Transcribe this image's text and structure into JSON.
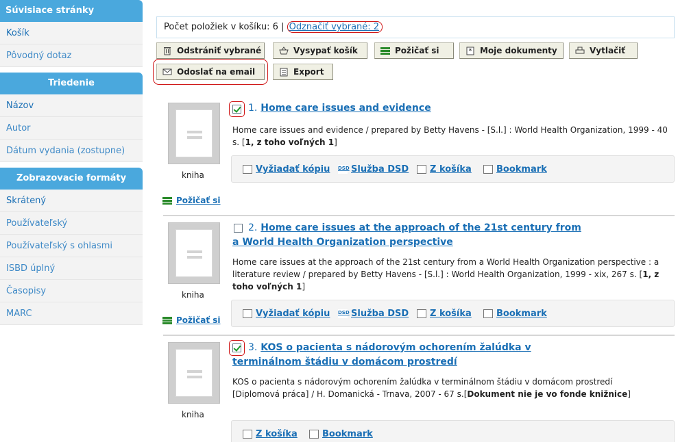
{
  "sidebar": {
    "related_title": "Súvisiace stránky",
    "related_items": [
      "Košík",
      "Pôvodný dotaz"
    ],
    "sort_title": "Triedenie",
    "sort_items": [
      "Názov",
      "Autor",
      "Dátum vydania (zostupne)"
    ],
    "formats_title": "Zobrazovacie formáty",
    "formats_items": [
      "Skrátený",
      "Používateľský",
      "Používateľský s ohlasmi",
      "ISBD úplný",
      "Časopisy",
      "MARC"
    ]
  },
  "cart": {
    "count_label": "Počet položiek v košíku: 6 |",
    "deselect_label": "Odznačiť vybrané: 2"
  },
  "toolbar": {
    "remove": "Odstrániť vybrané",
    "empty": "Vysypať košík",
    "borrow": "Požičať si",
    "mydocs": "Moje dokumenty",
    "print": "Vytlačiť",
    "email": "Odoslať na email",
    "export": "Export"
  },
  "records": [
    {
      "num": "1.",
      "title": "Home care issues and evidence",
      "desc": "Home care issues and evidence / prepared by Betty Havens - [S.l.] : World Health Organization, 1999 - 40 s. [",
      "avail": "1, z toho voľných 1",
      "desc_end": "]",
      "type": "kniha",
      "checked": true,
      "actions": [
        "Vyžiadať kópiu",
        "Služba DSD",
        "Z košíka",
        "Bookmark"
      ],
      "borrow": "Požičať si"
    },
    {
      "num": "2.",
      "title": "Home care issues at the approach of the 21st century from a World Health Organization perspective",
      "desc": "Home care issues at the approach of the 21st century from a World Health Organization perspective : a literature review / prepared by Betty Havens - [S.l.] : World Health Organization, 1999 - xix, 267 s. [",
      "avail": "1, z toho voľných 1",
      "desc_end": "]",
      "type": "kniha",
      "checked": false,
      "actions": [
        "Vyžiadať kópiu",
        "Služba DSD",
        "Z košíka",
        "Bookmark"
      ],
      "borrow": "Požičať si"
    },
    {
      "num": "3.",
      "title": "KOS o pacienta s nádorovým ochorením žalúdka v terminálnom štádiu v domácom prostredí",
      "desc": "KOS o pacienta s nádorovým ochorením žalúdka v terminálnom štádiu v domácom prostredí [Diplomová práca] / H. Domanická - Trnava, 2007 - 67 s.[",
      "avail": "Dokument nie je vo fonde knižnice",
      "desc_end": "]",
      "type": "kniha",
      "checked": true,
      "actions": [
        "Z košíka",
        "Bookmark"
      ]
    }
  ]
}
